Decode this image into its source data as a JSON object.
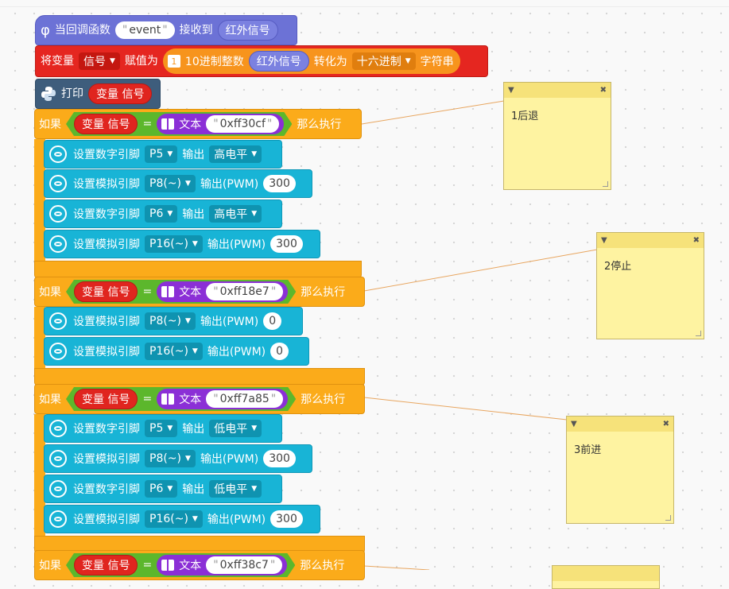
{
  "hat": {
    "label_when": "当回调函数",
    "param": "event",
    "label_recv": "接收到",
    "signal": "红外信号"
  },
  "setvar": {
    "label_set": "将变量",
    "var": "信号",
    "label_assign": "赋值为",
    "conv_label": "10进制整数",
    "conv_src": "红外信号",
    "label_to": "转化为",
    "format": "十六进制",
    "label_str": "字符串",
    "badge": "1"
  },
  "print": {
    "label": "打印",
    "var_label": "变量 信号"
  },
  "if_blocks": [
    {
      "if": "如果",
      "var": "变量 信号",
      "eq": "=",
      "text_label": "文本",
      "value": "0xff30cf",
      "then": "那么执行",
      "stmts": [
        {
          "kind": "digital",
          "label": "设置数字引脚",
          "pin": "P5",
          "out": "输出",
          "val": "高电平"
        },
        {
          "kind": "analog",
          "label": "设置模拟引脚",
          "pin": "P8(~)",
          "out": "输出(PWM)",
          "val": "300"
        },
        {
          "kind": "digital",
          "label": "设置数字引脚",
          "pin": "P6",
          "out": "输出",
          "val": "高电平"
        },
        {
          "kind": "analog",
          "label": "设置模拟引脚",
          "pin": "P16(~)",
          "out": "输出(PWM)",
          "val": "300"
        }
      ]
    },
    {
      "if": "如果",
      "var": "变量 信号",
      "eq": "=",
      "text_label": "文本",
      "value": "0xff18e7",
      "then": "那么执行",
      "stmts": [
        {
          "kind": "analog",
          "label": "设置模拟引脚",
          "pin": "P8(~)",
          "out": "输出(PWM)",
          "val": "0"
        },
        {
          "kind": "analog",
          "label": "设置模拟引脚",
          "pin": "P16(~)",
          "out": "输出(PWM)",
          "val": "0"
        }
      ]
    },
    {
      "if": "如果",
      "var": "变量 信号",
      "eq": "=",
      "text_label": "文本",
      "value": "0xff7a85",
      "then": "那么执行",
      "stmts": [
        {
          "kind": "digital",
          "label": "设置数字引脚",
          "pin": "P5",
          "out": "输出",
          "val": "低电平"
        },
        {
          "kind": "analog",
          "label": "设置模拟引脚",
          "pin": "P8(~)",
          "out": "输出(PWM)",
          "val": "300"
        },
        {
          "kind": "digital",
          "label": "设置数字引脚",
          "pin": "P6",
          "out": "输出",
          "val": "低电平"
        },
        {
          "kind": "analog",
          "label": "设置模拟引脚",
          "pin": "P16(~)",
          "out": "输出(PWM)",
          "val": "300"
        }
      ]
    },
    {
      "if": "如果",
      "var": "变量 信号",
      "eq": "=",
      "text_label": "文本",
      "value": "0xff38c7",
      "then": "那么执行",
      "stmts": []
    }
  ],
  "notes": [
    {
      "text": "1后退"
    },
    {
      "text": "2停止"
    },
    {
      "text": "3前进"
    }
  ],
  "colors": {
    "hat": "#6c72d6",
    "set": "#e52620",
    "python": "#3e5d7c",
    "if": "#fbab1a",
    "pin": "#18b4d6",
    "compare": "#5cb72c",
    "text": "#8b2fd6",
    "note": "#fef3a1"
  }
}
